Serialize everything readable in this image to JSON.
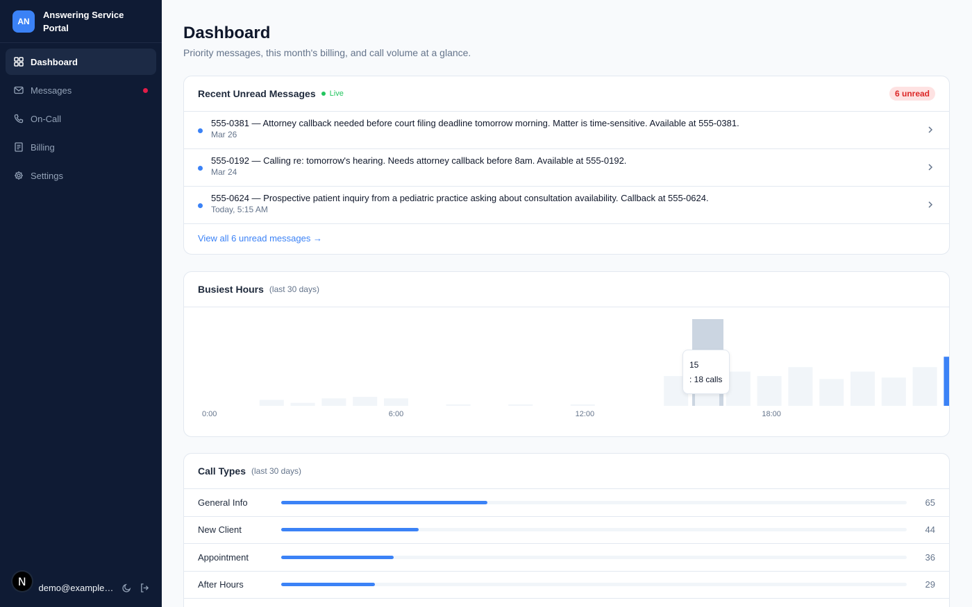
{
  "brand": {
    "initials": "AN",
    "name": "Answering Service Portal"
  },
  "nav": [
    {
      "label": "Dashboard",
      "icon": "dashboard-icon",
      "active": true
    },
    {
      "label": "Messages",
      "icon": "mail-icon",
      "unread_dot": true
    },
    {
      "label": "On-Call",
      "icon": "phone-icon"
    },
    {
      "label": "Billing",
      "icon": "receipt-icon"
    },
    {
      "label": "Settings",
      "icon": "gear-icon"
    }
  ],
  "user": {
    "avatar_letter": "N",
    "email": "demo@example.com"
  },
  "page": {
    "title": "Dashboard",
    "subtitle": "Priority messages, this month's billing, and call volume at a glance."
  },
  "messages_card": {
    "title": "Recent Unread Messages",
    "live": "Live",
    "badge": "6 unread",
    "items": [
      {
        "text": "555-0381 — Attorney callback needed before court filing deadline tomorrow morning. Matter is time-sensitive. Available at 555-0381.",
        "date": "Mar 26"
      },
      {
        "text": "555-0192 — Calling re: tomorrow's hearing. Needs attorney callback before 8am. Available at 555-0192.",
        "date": "Mar 24"
      },
      {
        "text": "555-0624 — Prospective patient inquiry from a pediatric practice asking about consultation availability. Callback at 555-0624.",
        "date": "Today, 5:15 AM"
      }
    ],
    "view_all": "View all 6 unread messages →"
  },
  "busiest_card": {
    "title": "Busiest Hours",
    "note": "(last 30 days)",
    "tooltip": {
      "line1": "15",
      "line2": ": 18 calls"
    }
  },
  "chart_data": {
    "type": "bar",
    "title": "Busiest Hours",
    "categories": [
      "0:00",
      "1:00",
      "2:00",
      "3:00",
      "4:00",
      "5:00",
      "6:00",
      "7:00",
      "8:00",
      "9:00",
      "10:00",
      "11:00",
      "12:00",
      "13:00",
      "14:00",
      "15:00",
      "16:00",
      "17:00",
      "18:00",
      "19:00",
      "20:00",
      "21:00",
      "22:00",
      "23:00"
    ],
    "values": [
      0,
      2,
      1,
      2.5,
      3,
      2.5,
      0,
      0.5,
      0,
      0.5,
      0,
      0.5,
      0,
      0,
      10,
      18,
      11.5,
      10,
      13,
      9,
      11.5,
      9.5,
      13,
      16.5
    ],
    "x_tick_labels": [
      "0:00",
      "6:00",
      "12:00",
      "18:00"
    ],
    "highlight_index": 23,
    "hover_index": 15,
    "colors": {
      "bar": "#f1f5f9",
      "highlight": "#3b82f6",
      "hover": "#cbd5e1"
    }
  },
  "call_types_card": {
    "title": "Call Types",
    "note": "(last 30 days)",
    "rows": [
      {
        "label": "General Info",
        "value": "65",
        "fraction": 0.33
      },
      {
        "label": "New Client",
        "value": "44",
        "fraction": 0.22
      },
      {
        "label": "Appointment",
        "value": "36",
        "fraction": 0.18
      },
      {
        "label": "After Hours",
        "value": "29",
        "fraction": 0.15
      }
    ]
  }
}
